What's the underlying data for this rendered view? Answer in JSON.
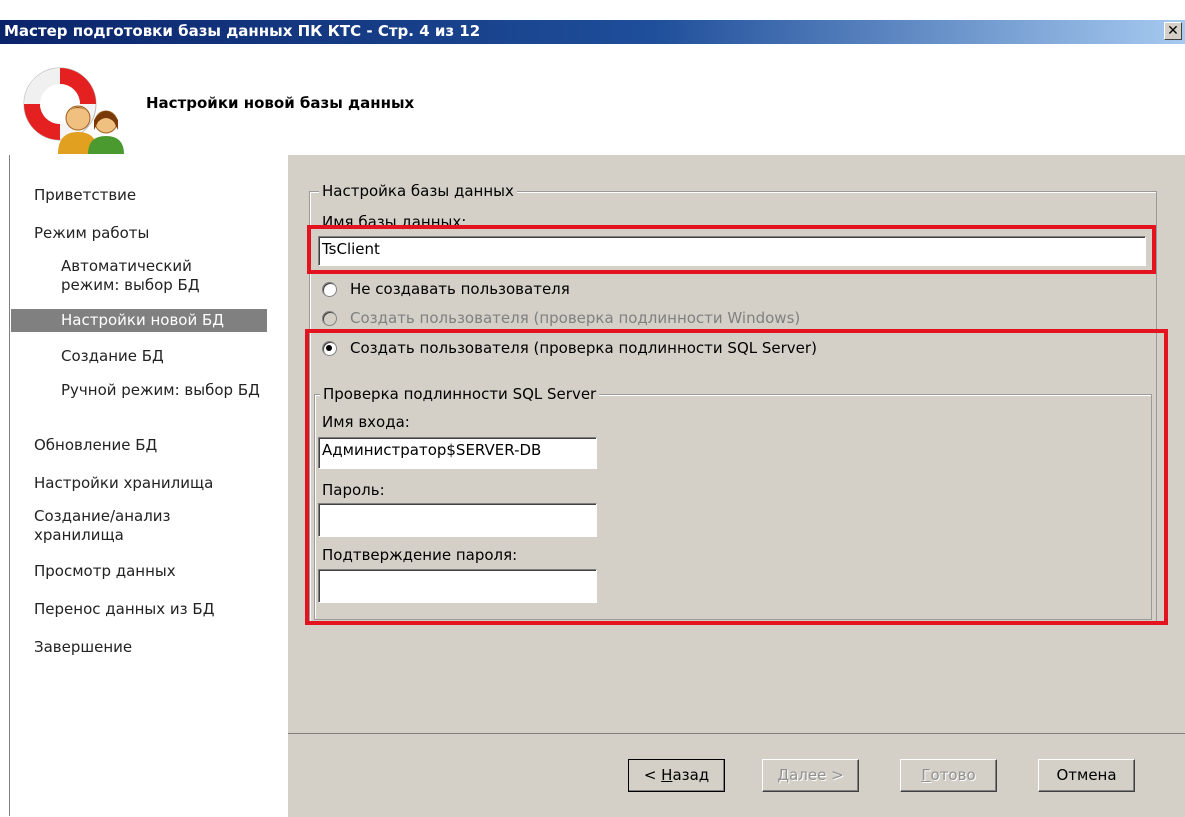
{
  "window": {
    "title": "Мастер подготовки базы данных ПК КТС - Стр. 4 из 12",
    "close_label": "✕"
  },
  "header": {
    "title": "Настройки новой базы данных"
  },
  "nav": {
    "items": [
      {
        "label": "Приветствие"
      },
      {
        "label": "Режим работы"
      },
      {
        "label": "Автоматический режим: выбор БД"
      },
      {
        "label": "Настройки новой БД",
        "selected": true
      },
      {
        "label": "Создание БД"
      },
      {
        "label": "Ручной режим: выбор БД"
      },
      {
        "label": "Обновление БД"
      },
      {
        "label": "Настройки хранилища"
      },
      {
        "label": "Создание/анализ хранилища"
      },
      {
        "label": "Просмотр данных"
      },
      {
        "label": "Перенос данных из БД"
      },
      {
        "label": "Завершение"
      }
    ]
  },
  "db_settings": {
    "group_title": "Настройка базы данных",
    "db_name_label": "Имя базы данных:",
    "db_name_value": "TsClient",
    "radio_no_user": "Не создавать пользователя",
    "radio_windows_auth": "Создать пользователя (проверка подлинности Windows)",
    "radio_sql_auth": "Создать пользователя (проверка подлинности SQL Server)",
    "selected_option": "radio_sql_auth"
  },
  "sql_auth": {
    "group_title": "Проверка подлинности SQL Server",
    "login_label": "Имя входа:",
    "login_value": "Администратор$SERVER-DB",
    "password_label": "Пароль:",
    "password_value": "",
    "confirm_label": "Подтверждение пароля:",
    "confirm_value": ""
  },
  "buttons": {
    "back_underlined": "Н",
    "back_rest": "азад",
    "back_prefix": "< ",
    "next_underlined": "Д",
    "next_rest": "алее >",
    "finish_underlined": "Г",
    "finish_rest": "отово",
    "cancel": "Отмена"
  },
  "colors": {
    "highlight_border": "#e3141f",
    "title_bar": "#0a246a",
    "dialog_bg": "#d4d0c8"
  }
}
